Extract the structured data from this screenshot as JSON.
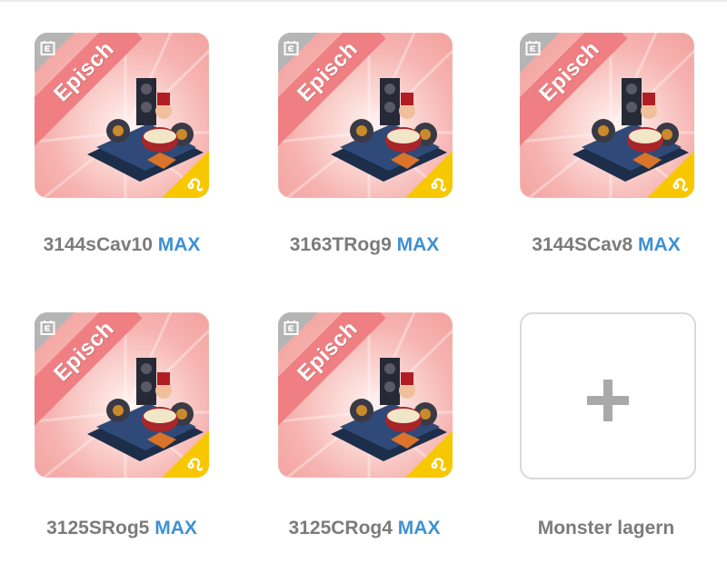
{
  "max_label": "MAX",
  "rarity_label": "Episch",
  "icons": {
    "event": "calendar-event-icon",
    "element": "leo-sign-icon",
    "add": "plus-icon"
  },
  "colors": {
    "card_bg": "#f6b3b0",
    "ribbon": "#ef7f82",
    "max_text": "#3e91d4",
    "name_text": "#7b7b7b",
    "element_corner": "#f7c800"
  },
  "monsters": [
    {
      "name": "3144sCav10",
      "max": "MAX",
      "rarity": "Episch"
    },
    {
      "name": "3163TRog9",
      "max": "MAX",
      "rarity": "Episch"
    },
    {
      "name": "3144SCav8",
      "max": "MAX",
      "rarity": "Episch"
    },
    {
      "name": "3125SRog5",
      "max": "MAX",
      "rarity": "Episch"
    },
    {
      "name": "3125CRog4",
      "max": "MAX",
      "rarity": "Episch"
    }
  ],
  "store_slot": {
    "label": "Monster lagern"
  }
}
